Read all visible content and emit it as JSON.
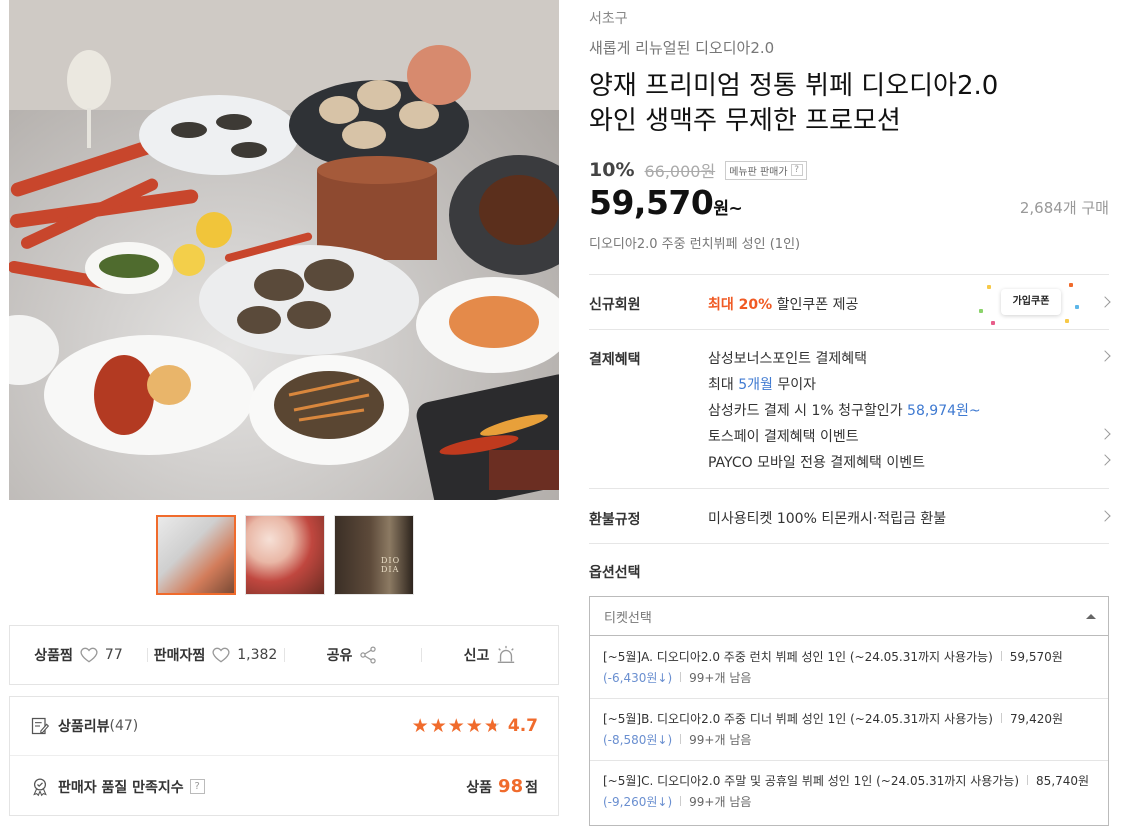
{
  "product": {
    "region": "서초구",
    "subtitle": "새롭게 리뉴얼된 디오디아2.0",
    "title_line1": "양재 프리미엄 정통 뷔페 디오디아2.0",
    "title_line2": "와인 생맥주 무제한 프로모션",
    "discount": "10%",
    "original_price": "66,000원",
    "menu_badge": "메뉴판 판매가",
    "menu_badge_q": "?",
    "price": "59,570",
    "price_unit": "원~",
    "sold_count": "2,684개 구매",
    "description": "디오디아2.0 주중 런치뷔페 성인 (1인)"
  },
  "benefits": {
    "new_member": {
      "label": "신규회원",
      "highlight": "최대 20%",
      "text": "할인쿠폰 제공",
      "coupon_label": "가입쿠폰"
    },
    "payment": {
      "label": "결제혜택",
      "lines": [
        {
          "text": "삼성보너스포인트 결제혜택"
        },
        {
          "pre": "최대 ",
          "hl": "5개월",
          "post": " 무이자"
        },
        {
          "pre": "삼성카드 결제 시 1% 청구할인가 ",
          "hl": "58,974원~",
          "post": ""
        },
        {
          "text": "토스페이 결제혜택 이벤트"
        },
        {
          "text": "PAYCO 모바일 전용 결제혜택 이벤트"
        }
      ]
    },
    "refund": {
      "label": "환불규정",
      "text": "미사용티켓 100% 티몬캐시·적립금 환불"
    }
  },
  "options": {
    "label": "옵션선택",
    "placeholder": "티켓선택",
    "items": [
      {
        "name": "[~5월]A. 디오디아2.0 주중 런치 뷔페 성인 1인 (~24.05.31까지 사용가능)",
        "price": "59,570원",
        "discount": "(-6,430원↓)",
        "stock": "99+개 남음"
      },
      {
        "name": "[~5월]B. 디오디아2.0 주중 디너 뷔페 성인 1인 (~24.05.31까지 사용가능)",
        "price": "79,420원",
        "discount": "(-8,580원↓)",
        "stock": "99+개 남음"
      },
      {
        "name": "[~5월]C. 디오디아2.0 주말 및 공휴일 뷔페 성인 1인 (~24.05.31까지 사용가능)",
        "price": "85,740원",
        "discount": "(-9,260원↓)",
        "stock": "99+개 남음"
      }
    ]
  },
  "social": {
    "wish_label": "상품찜",
    "wish_count": "77",
    "seller_label": "판매자찜",
    "seller_count": "1,382",
    "share_label": "공유",
    "report_label": "신고"
  },
  "review": {
    "label": "상품리뷰",
    "count": "(47)",
    "rating": "4.7",
    "quality_label": "판매자 품질 만족지수",
    "quality_q": "?",
    "quality_prefix": "상품",
    "quality_score": "98",
    "quality_suffix": "점"
  },
  "thumbnails": {
    "logo_text": "DIO DIA"
  },
  "colors": {
    "accent": "#f06b2c",
    "highlight_red": "#f05a24",
    "link_blue": "#3f7ad1"
  }
}
